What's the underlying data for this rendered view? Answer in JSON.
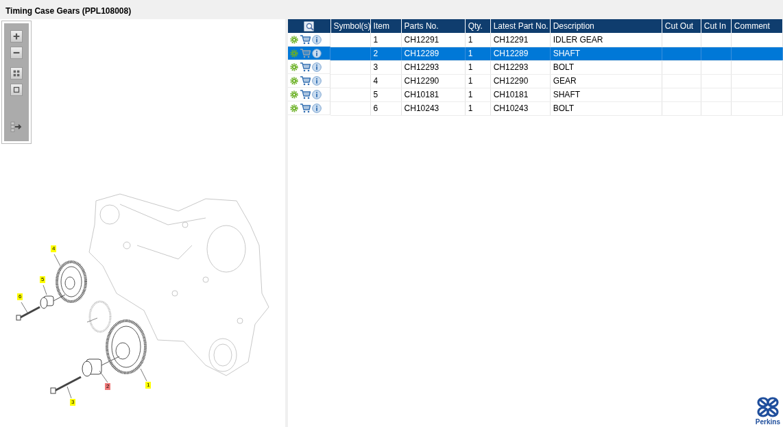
{
  "window": {
    "title": "Timing Case Gears (PPL108008)"
  },
  "diagram": {
    "callouts": [
      {
        "label": "4",
        "selected": false
      },
      {
        "label": "5",
        "selected": false
      },
      {
        "label": "6",
        "selected": false
      },
      {
        "label": "2",
        "selected": true
      },
      {
        "label": "1",
        "selected": false
      },
      {
        "label": "3",
        "selected": false
      }
    ]
  },
  "table": {
    "columns": [
      "Symbol(s)",
      "Item",
      "Parts No.",
      "Qty.",
      "Latest Part No.",
      "Description",
      "Cut Out",
      "Cut In",
      "Comment"
    ],
    "rows": [
      {
        "selected": false,
        "cells": [
          "",
          "1",
          "CH12291",
          "1",
          "CH12291",
          "IDLER GEAR",
          "",
          "",
          ""
        ]
      },
      {
        "selected": true,
        "cells": [
          "",
          "2",
          "CH12289",
          "1",
          "CH12289",
          "SHAFT",
          "",
          "",
          ""
        ]
      },
      {
        "selected": false,
        "cells": [
          "",
          "3",
          "CH12293",
          "1",
          "CH12293",
          "BOLT",
          "",
          "",
          ""
        ]
      },
      {
        "selected": false,
        "cells": [
          "",
          "4",
          "CH12290",
          "1",
          "CH12290",
          "GEAR",
          "",
          "",
          ""
        ]
      },
      {
        "selected": false,
        "cells": [
          "",
          "5",
          "CH10181",
          "1",
          "CH10181",
          "SHAFT",
          "",
          "",
          ""
        ]
      },
      {
        "selected": false,
        "cells": [
          "",
          "6",
          "CH10243",
          "1",
          "CH10243",
          "BOLT",
          "",
          "",
          ""
        ]
      }
    ]
  },
  "logo": {
    "text": "Perkins"
  }
}
